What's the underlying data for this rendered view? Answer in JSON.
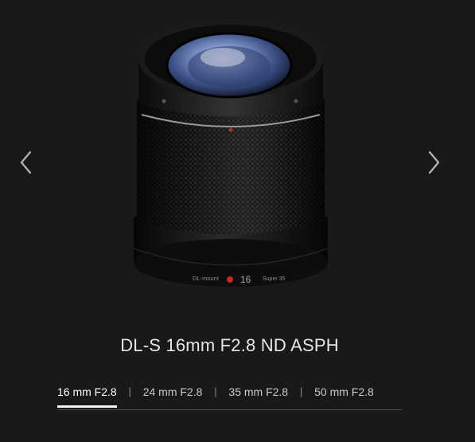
{
  "navigation": {
    "prev_icon": "chevron-left-icon",
    "next_icon": "chevron-right-icon"
  },
  "product": {
    "title": "DL-S 16mm F2.8 ND ASPH",
    "lens_marking_mount": "DL-mount",
    "lens_marking_focal": "16",
    "lens_marking_sensor": "Super 35"
  },
  "tabs": [
    {
      "label": "16 mm F2.8",
      "active": true
    },
    {
      "label": "24 mm F2.8",
      "active": false
    },
    {
      "label": "35 mm F2.8",
      "active": false
    },
    {
      "label": "50 mm F2.8",
      "active": false
    }
  ],
  "tab_separator": "|",
  "colors": {
    "background": "#191919",
    "text": "#e6e6e6",
    "accent_dot": "#c62828"
  }
}
